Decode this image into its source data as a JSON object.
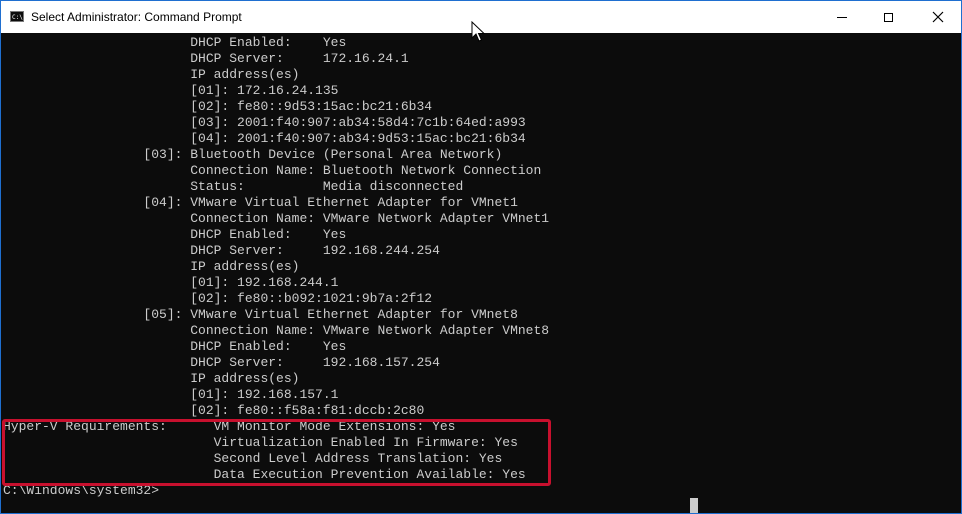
{
  "window": {
    "title": "Select Administrator: Command Prompt",
    "icon_text": "C:\\."
  },
  "controls": {
    "minimize": "minimize-icon",
    "maximize": "maximize-icon",
    "close": "close-icon",
    "close_glyph": "✕"
  },
  "console": {
    "lines": [
      "                        DHCP Enabled:    Yes",
      "                        DHCP Server:     172.16.24.1",
      "                        IP address(es)",
      "                        [01]: 172.16.24.135",
      "                        [02]: fe80::9d53:15ac:bc21:6b34",
      "                        [03]: 2001:f40:907:ab34:58d4:7c1b:64ed:a993",
      "                        [04]: 2001:f40:907:ab34:9d53:15ac:bc21:6b34",
      "                  [03]: Bluetooth Device (Personal Area Network)",
      "                        Connection Name: Bluetooth Network Connection",
      "                        Status:          Media disconnected",
      "                  [04]: VMware Virtual Ethernet Adapter for VMnet1",
      "                        Connection Name: VMware Network Adapter VMnet1",
      "                        DHCP Enabled:    Yes",
      "                        DHCP Server:     192.168.244.254",
      "                        IP address(es)",
      "                        [01]: 192.168.244.1",
      "                        [02]: fe80::b092:1021:9b7a:2f12",
      "                  [05]: VMware Virtual Ethernet Adapter for VMnet8",
      "                        Connection Name: VMware Network Adapter VMnet8",
      "                        DHCP Enabled:    Yes",
      "                        DHCP Server:     192.168.157.254",
      "                        IP address(es)",
      "                        [01]: 192.168.157.1",
      "                        [02]: fe80::f58a:f81:dccb:2c80",
      "Hyper-V Requirements:      VM Monitor Mode Extensions: Yes",
      "                           Virtualization Enabled In Firmware: Yes",
      "                           Second Level Address Translation: Yes",
      "                           Data Execution Prevention Available: Yes",
      "",
      "C:\\Windows\\system32>"
    ]
  }
}
